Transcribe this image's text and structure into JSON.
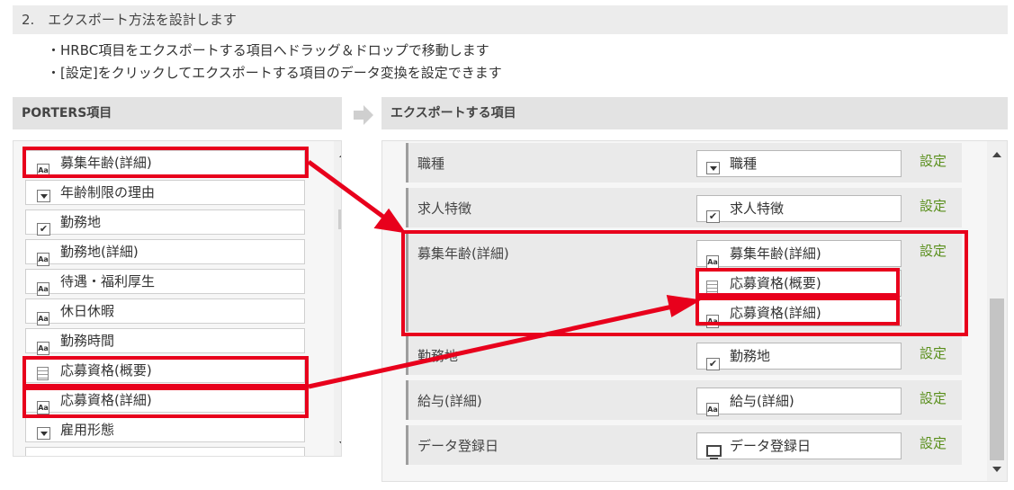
{
  "step": {
    "title": "2.　エクスポート方法を設計します"
  },
  "instructions": [
    "・HRBC項目をエクスポートする項目へドラッグ＆ドロップで移動します",
    "・[設定]をクリックしてエクスポートする項目のデータ変換を設定できます"
  ],
  "left_panel": {
    "title": "PORTERS項目",
    "items": [
      {
        "label": "募集年齢(詳細)",
        "icon": "text-field-icon"
      },
      {
        "label": "年齢制限の理由",
        "icon": "dropdown-icon"
      },
      {
        "label": "勤務地",
        "icon": "checkbox-icon"
      },
      {
        "label": "勤務地(詳細)",
        "icon": "text-field-icon"
      },
      {
        "label": "待遇・福利厚生",
        "icon": "text-field-icon"
      },
      {
        "label": "休日休暇",
        "icon": "text-field-icon"
      },
      {
        "label": "勤務時間",
        "icon": "text-field-icon"
      },
      {
        "label": "応募資格(概要)",
        "icon": "document-icon"
      },
      {
        "label": "応募資格(詳細)",
        "icon": "text-field-icon"
      },
      {
        "label": "雇用形態",
        "icon": "dropdown-icon"
      }
    ]
  },
  "right_panel": {
    "title": "エクスポートする項目",
    "setting_link": "設定",
    "rows": [
      {
        "label": "職種",
        "fields": [
          {
            "label": "職種",
            "icon": "dropdown-icon"
          }
        ]
      },
      {
        "label": "求人特徴",
        "fields": [
          {
            "label": "求人特徴",
            "icon": "checkbox-icon"
          }
        ]
      },
      {
        "label": "募集年齢(詳細)",
        "fields": [
          {
            "label": "募集年齢(詳細)",
            "icon": "text-field-icon"
          },
          {
            "label": "応募資格(概要)",
            "icon": "document-icon"
          },
          {
            "label": "応募資格(詳細)",
            "icon": "text-field-icon"
          }
        ]
      },
      {
        "label": "勤務地",
        "fields": [
          {
            "label": "勤務地",
            "icon": "checkbox-icon"
          }
        ]
      },
      {
        "label": "給与(詳細)",
        "fields": [
          {
            "label": "給与(詳細)",
            "icon": "text-field-icon"
          }
        ]
      },
      {
        "label": "データ登録日",
        "fields": [
          {
            "label": "データ登録日",
            "icon": "monitor-icon"
          }
        ]
      }
    ]
  },
  "annotation": {
    "highlight_color": "#e8001c"
  }
}
